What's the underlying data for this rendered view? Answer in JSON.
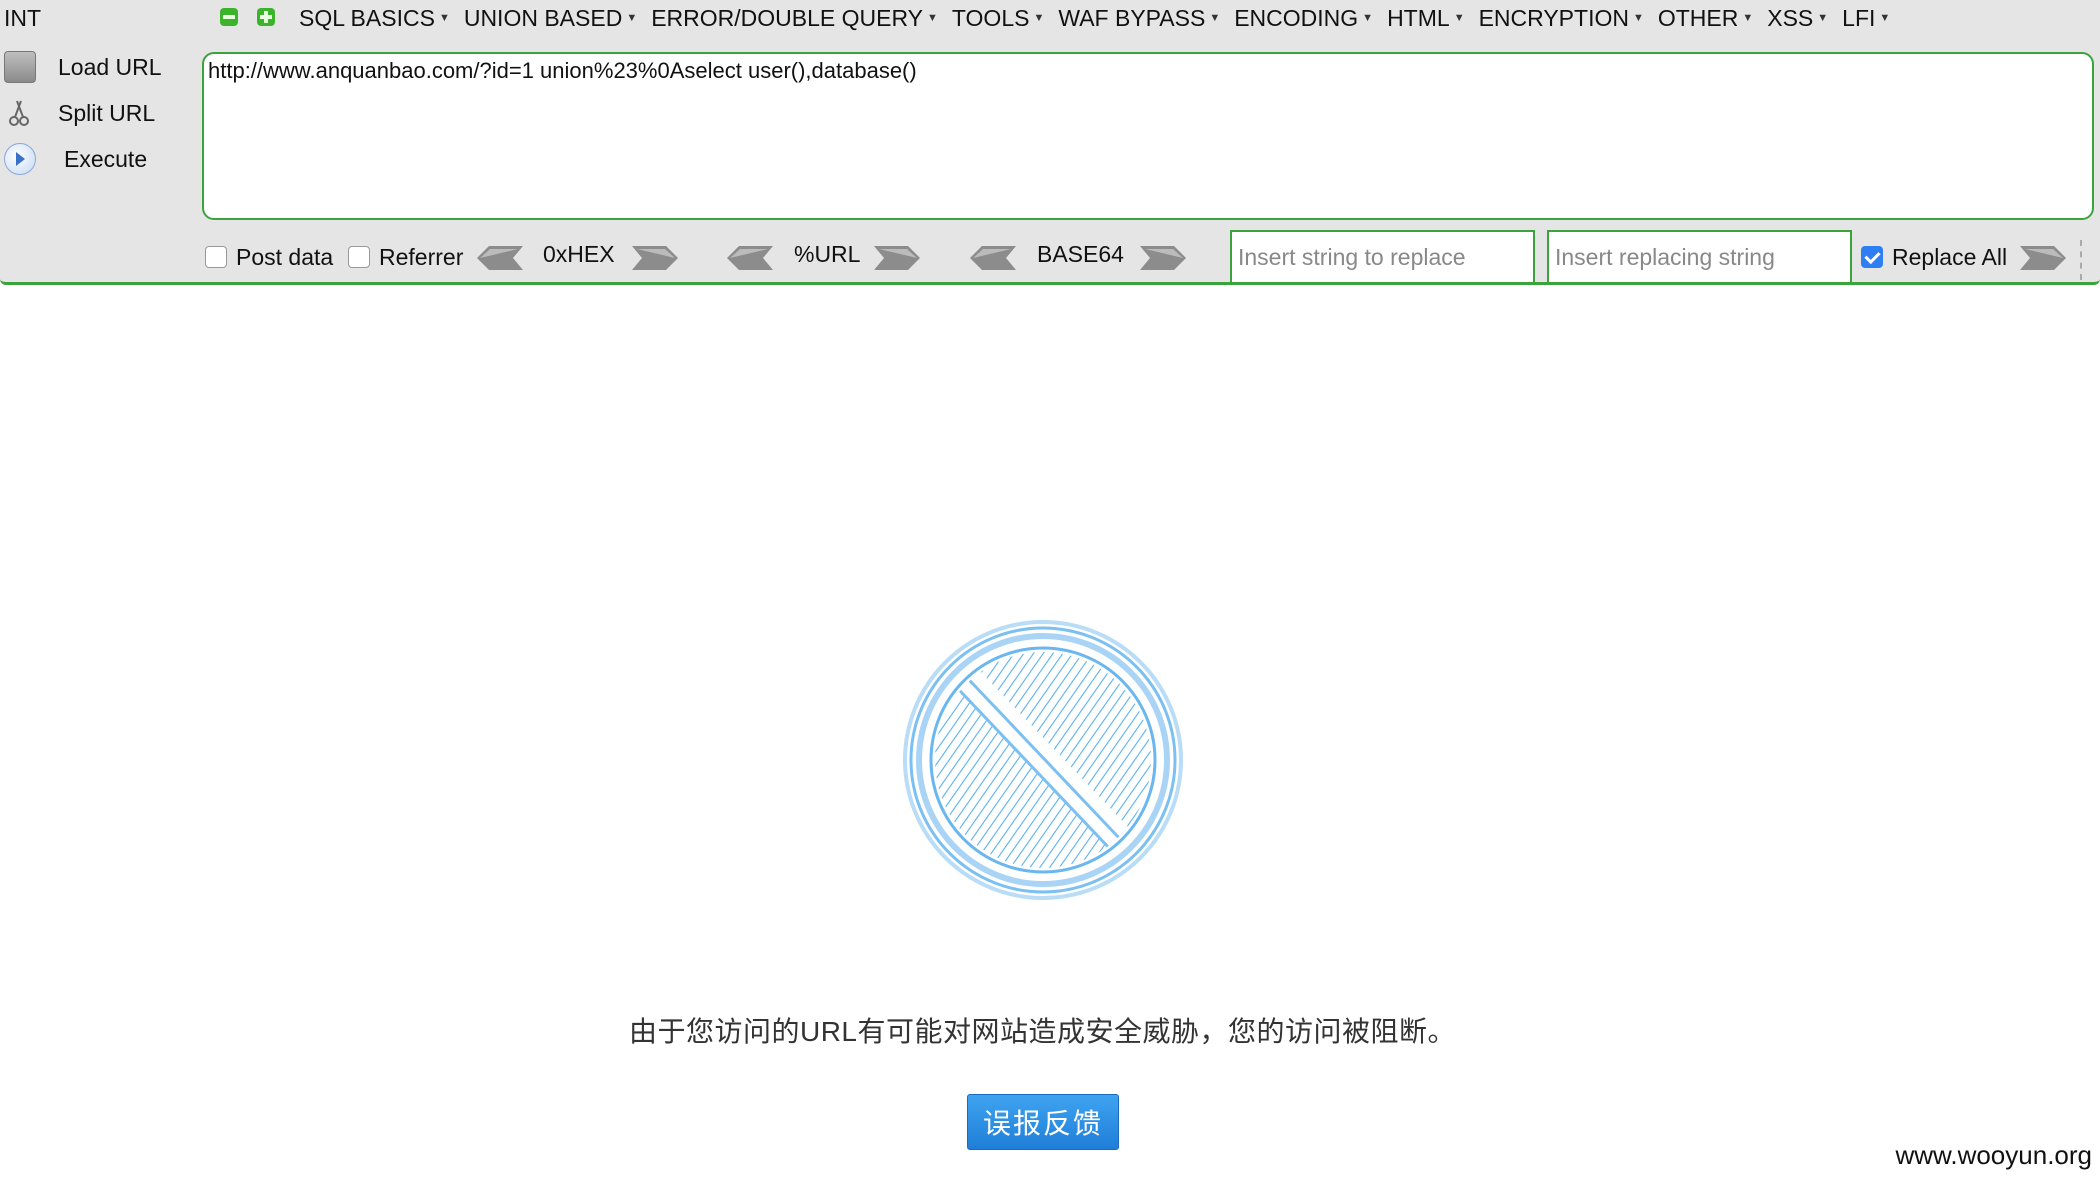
{
  "hackbar": {
    "int_label": "INT",
    "menu": [
      {
        "label": "SQL BASICS"
      },
      {
        "label": "UNION BASED"
      },
      {
        "label": "ERROR/DOUBLE QUERY"
      },
      {
        "label": "TOOLS"
      },
      {
        "label": "WAF BYPASS"
      },
      {
        "label": "ENCODING"
      },
      {
        "label": "HTML"
      },
      {
        "label": "ENCRYPTION"
      },
      {
        "label": "OTHER"
      },
      {
        "label": "XSS"
      },
      {
        "label": "LFI"
      }
    ],
    "commands": {
      "load": "Load URL",
      "split": "Split URL",
      "execute": "Execute"
    },
    "url_value": "http://www.anquanbao.com/?id=1 union%23%0Aselect user(),database()",
    "post_data": {
      "label": "Post data",
      "checked": false
    },
    "referrer": {
      "label": "Referrer",
      "checked": false
    },
    "encoders": {
      "hex": "0xHEX",
      "url": "%URL",
      "base64": "BASE64"
    },
    "replace": {
      "find_placeholder": "Insert string to replace",
      "replace_placeholder": "Insert replacing string",
      "replace_all_label": "Replace All",
      "replace_all_checked": true
    },
    "accent_color": "#3ba33b"
  },
  "block_page": {
    "icon": "ban-icon",
    "message": "由于您访问的URL有可能对网站造成安全威胁，您的访问被阻断。",
    "report_button": "误报反馈",
    "icon_color": "#5bb0ee",
    "button_color": "#2b8fe6"
  },
  "watermark": "www.wooyun.org"
}
